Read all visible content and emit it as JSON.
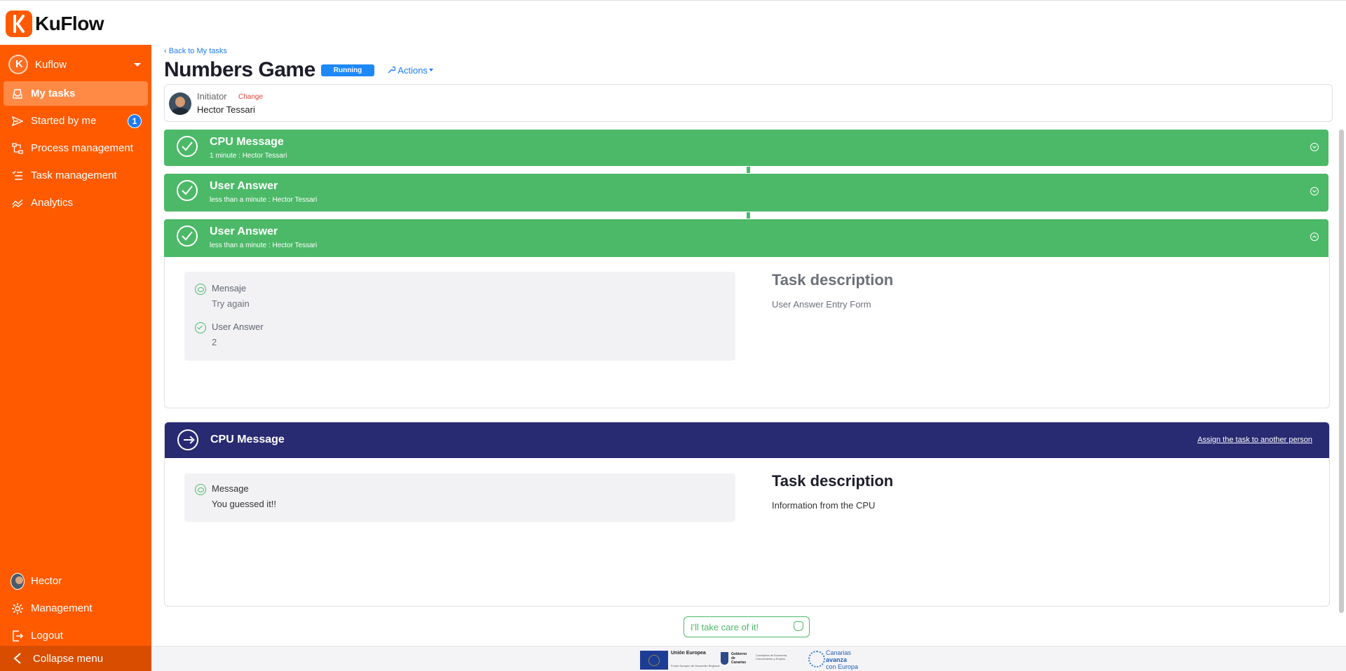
{
  "app": {
    "name": "KuFlow"
  },
  "sidebar": {
    "org": "Kuflow",
    "items": [
      {
        "label": "My tasks",
        "icon": "inbox-icon",
        "active": true
      },
      {
        "label": "Started by me",
        "icon": "send-icon",
        "badge": "1"
      },
      {
        "label": "Process management",
        "icon": "process-icon"
      },
      {
        "label": "Task management",
        "icon": "task-list-icon"
      },
      {
        "label": "Analytics",
        "icon": "analytics-icon"
      }
    ],
    "user": "Hector",
    "management": "Management",
    "logout": "Logout",
    "collapse": "Collapse menu"
  },
  "page": {
    "back": "Back to My tasks",
    "title": "Numbers Game",
    "status": "Running",
    "actions": "Actions"
  },
  "initiator": {
    "label": "Initiator",
    "change": "Change",
    "name": "Hector Tessari"
  },
  "tasks": [
    {
      "title": "CPU Message",
      "subtitle": "1 minute : Hector Tessari"
    },
    {
      "title": "User Answer",
      "subtitle": "less than a minute : Hector Tessari"
    },
    {
      "title": "User Answer",
      "subtitle": "less than a minute : Hector Tessari"
    }
  ],
  "expanded": {
    "fields": [
      {
        "label": "Mensaje",
        "value": "Try again"
      },
      {
        "label": "User Answer",
        "value": "2"
      }
    ],
    "desc_title": "Task description",
    "desc_text": "User Answer Entry Form"
  },
  "current": {
    "title": "CPU Message",
    "assign": "Assign the task to another person",
    "field_label": "Message",
    "field_value": "You guessed it!!",
    "desc_title": "Task description",
    "desc_text": "Information from the CPU"
  },
  "take_care": "I'll take care of it!",
  "footer": {
    "eu_title": "Unión Europea",
    "eu_sub": "Fondo Europeo de Desarrollo Regional",
    "gob_title": "Gobierno de Canarias",
    "gob_sub": "Consejería de Economía, Conocimiento y Empleo",
    "can_1": "Canarias",
    "can_2": "avanza",
    "can_3": "con Europa"
  },
  "colors": {
    "brand": "#ff5a00",
    "completed": "#4cb968",
    "current": "#282a72",
    "link": "#1e7cf2"
  }
}
